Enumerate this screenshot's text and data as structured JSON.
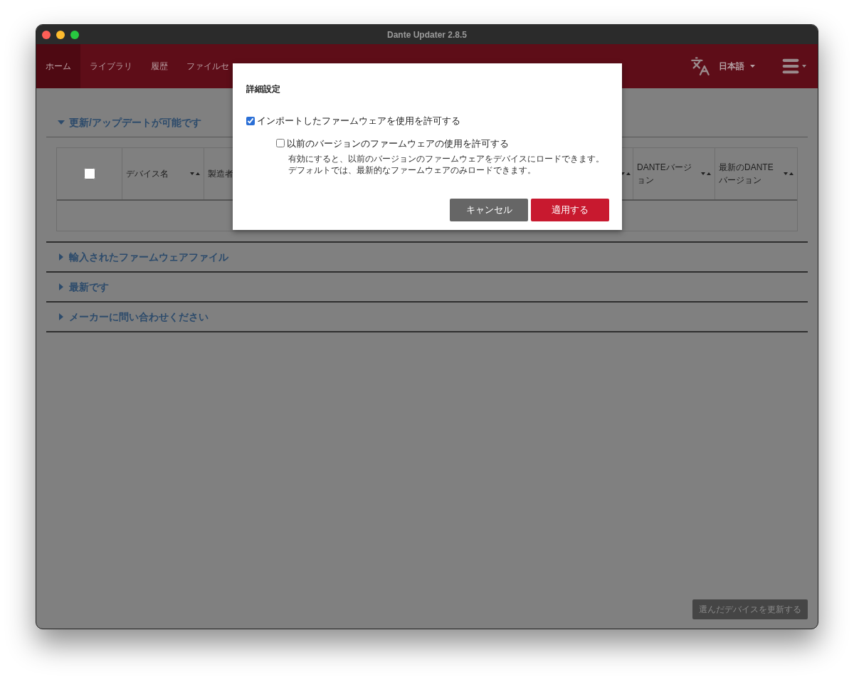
{
  "window": {
    "title": "Dante Updater 2.8.5"
  },
  "nav": {
    "tabs": [
      {
        "label": "ホーム",
        "selected": true
      },
      {
        "label": "ライブラリ",
        "selected": false
      },
      {
        "label": "履歴",
        "selected": false
      },
      {
        "label": "ファイルセ",
        "selected": false
      }
    ],
    "language": "日本語"
  },
  "sections": [
    {
      "label": "更新/アップデートが可能です",
      "expanded": true,
      "table": {
        "select_all_checked": false,
        "columns": [
          {
            "label": "デバイス名",
            "kind": "text"
          },
          {
            "label": "製造者",
            "kind": "cut"
          },
          {
            "kind": "hidden"
          },
          {
            "label": "DANTEバージョン",
            "kind": "text"
          },
          {
            "label": "最新のDANTEバージョン",
            "kind": "text"
          }
        ]
      }
    },
    {
      "label": "輸入されたファームウェアファイル",
      "expanded": false
    },
    {
      "label": "最新です",
      "expanded": false
    },
    {
      "label": "メーカーに問い合わせください",
      "expanded": false
    }
  ],
  "update_button": {
    "label": "選んだデバイスを更新する",
    "disabled": true
  },
  "dialog": {
    "title": "詳細設定",
    "options": [
      {
        "label": "インポートしたファームウェアを使用を許可する",
        "checked": true,
        "children": [
          {
            "label": "以前のバージョンのファームウェアの使用を許可する",
            "checked": false,
            "description": "有効にすると、以前のバージョンのファームウェアをデバイスにロードできます。デフォルトでは、最新的なファームウェアのみロードできます。"
          }
        ]
      }
    ],
    "buttons": [
      {
        "label": "キャンセル",
        "kind": "secondary"
      },
      {
        "label": "適用する",
        "kind": "primary"
      }
    ]
  }
}
